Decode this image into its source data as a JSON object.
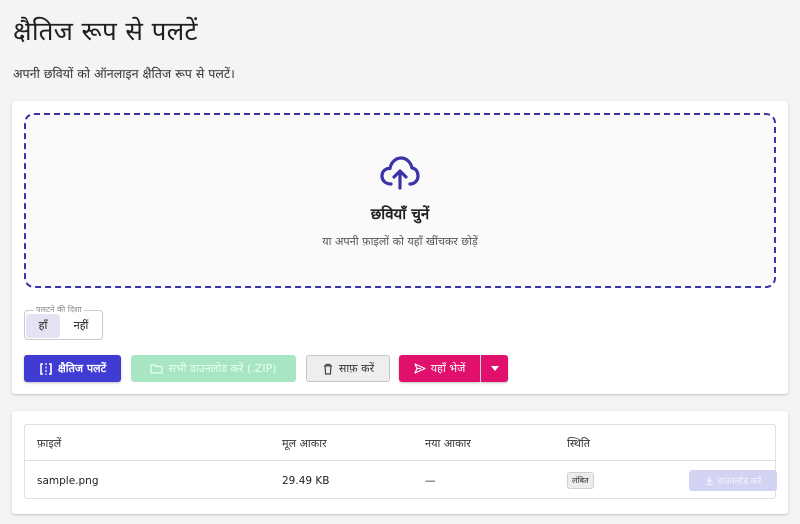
{
  "page": {
    "title": "क्षैतिज रूप से पलटें",
    "subtitle": "अपनी छवियों को ऑनलाइन क्षैतिज रूप से पलटें।"
  },
  "dropzone": {
    "icon": "cloud-upload-icon",
    "title": "छवियाँ चुनें",
    "hint": "या अपनी फ़ाइलों को यहाँ खींचकर छोड़ें"
  },
  "direction": {
    "legend": "पलटने की दिशा",
    "options": [
      "हाँ",
      "नहीं"
    ],
    "selected": "हाँ"
  },
  "actions": {
    "flip_label": "क्षैतिज पलटें",
    "zip_label": "सभी डाउनलोड करें (.ZIP)",
    "clear_label": "साफ़ करें",
    "send_label": "यहाँ भेजें"
  },
  "table": {
    "headers": [
      "फ़ाइलें",
      "मूल आकार",
      "नया आकार",
      "स्थिति"
    ],
    "rows": [
      {
        "file": "sample.png",
        "original_size": "29.49 KB",
        "new_size": "—",
        "status": "लंबित",
        "download_label": "डाउनलोड करें"
      }
    ]
  },
  "colors": {
    "primary": "#3f3bd3",
    "send": "#e0106c",
    "zip_disabled": "#a8e6c3",
    "dropzone_border": "#3b33a8"
  }
}
